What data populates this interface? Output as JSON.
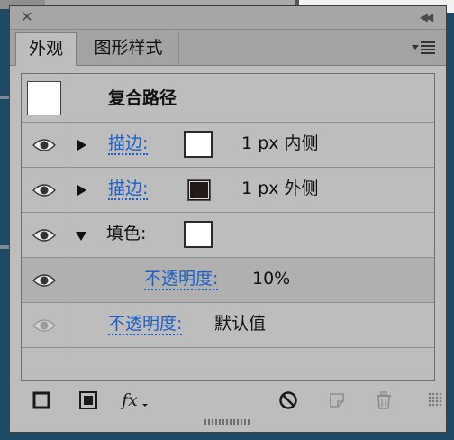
{
  "panel": {
    "tabs": [
      {
        "label": "外观",
        "active": true
      },
      {
        "label": "图形样式",
        "active": false
      }
    ]
  },
  "appearance": {
    "header": {
      "title": "复合路径"
    },
    "stroke1": {
      "label": "描边:",
      "value": "1 px  内侧",
      "swatch_color": "#ffffff"
    },
    "stroke2": {
      "label": "描边:",
      "value": "1 px  外侧",
      "swatch_color": "#221a18"
    },
    "fill": {
      "label": "填色:",
      "swatch_color": "#ffffff"
    },
    "fill_opacity": {
      "label": "不透明度:",
      "value": "10%"
    },
    "object_opacity": {
      "label": "不透明度:",
      "value": "默认值"
    }
  },
  "footer_icons": [
    "add-stroke-icon",
    "add-fill-icon",
    "fx-icon",
    "clear-appearance-icon",
    "duplicate-item-icon",
    "delete-item-icon"
  ],
  "colors": {
    "link": "#1f5fc5",
    "panel_bg": "#bdbdbd",
    "workspace_bg": "#1f4a66"
  }
}
